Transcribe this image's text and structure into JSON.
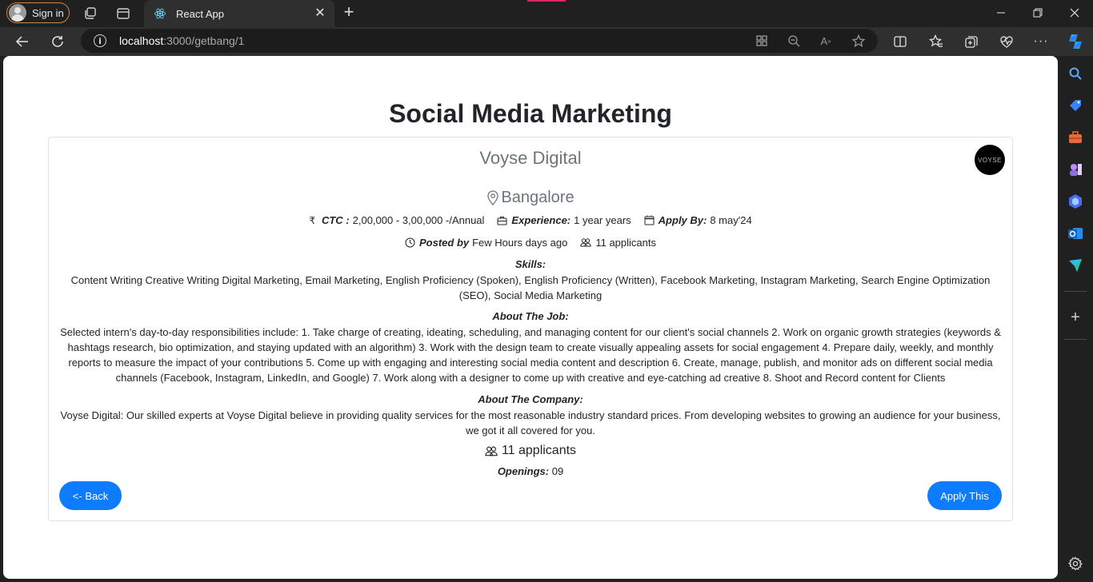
{
  "browser": {
    "signin_label": "Sign in",
    "tab_title": "React App",
    "url_host": "localhost",
    "url_path": ":3000/getbang/1"
  },
  "page": {
    "title": "Social Media Marketing",
    "company": "Voyse Digital",
    "logo_text": "VOYSE",
    "location": "Bangalore",
    "ctc_label": "CTC :",
    "ctc_value": "2,00,000 - 3,00,000 -/Annual",
    "experience_label": "Experience:",
    "experience_value": "1 year years",
    "apply_by_label": "Apply By:",
    "apply_by_value": "8 may'24",
    "posted_label": "Posted by",
    "posted_value": "Few Hours days ago",
    "applicants_small": "11 applicants",
    "skills_heading": "Skills:",
    "skills_text": "Content Writing Creative Writing Digital Marketing, Email Marketing, English Proficiency (Spoken), English Proficiency (Written), Facebook Marketing, Instagram Marketing, Search Engine Optimization (SEO), Social Media Marketing",
    "about_job_heading": "About The Job:",
    "about_job_text": "Selected intern's day-to-day responsibilities include: 1. Take charge of creating, ideating, scheduling, and managing content for our client's social channels 2. Work on organic growth strategies (keywords & hashtags research, bio optimization, and staying updated with an algorithm) 3. Work with the design team to create visually appealing assets for social engagement 4. Prepare daily, weekly, and monthly reports to measure the impact of your contributions 5. Come up with engaging and interesting social media content and description 6. Create, manage, publish, and monitor ads on different social media channels (Facebook, Instagram, LinkedIn, and Google) 7. Work along with a designer to come up with creative and eye-catching ad creative 8. Shoot and Record content for Clients",
    "about_company_heading": "About The Company:",
    "about_company_text": "Voyse Digital: Our skilled experts at Voyse Digital believe in providing quality services for the most reasonable industry standard prices. From developing websites to growing an audience for your business, we got it all covered for you.",
    "applicants_big": "11 applicants",
    "openings_label": "Openings:",
    "openings_value": "09",
    "back_label": "<- Back",
    "apply_label": "Apply This"
  },
  "colors": {
    "accent": "#0d7cff",
    "muted_text": "#6c757d",
    "body_text": "#212529"
  }
}
